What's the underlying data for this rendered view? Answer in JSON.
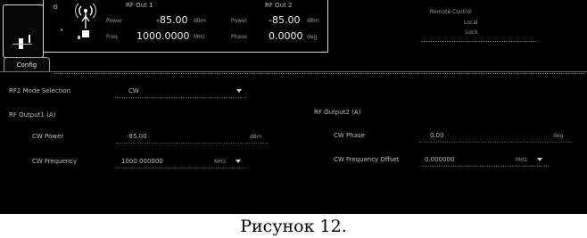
{
  "header": {
    "rf1": {
      "title": "RF Out 1",
      "power_label": "Power",
      "power_value": "-85.00",
      "power_unit": "dBm",
      "freq_label": "Freq",
      "freq_value": "1000.0000",
      "freq_unit": "MHz"
    },
    "rf2": {
      "title": "RF Out 2",
      "power_label": "Power",
      "power_value": "-85.00",
      "power_unit": "dBm",
      "phase_label": "Phase",
      "phase_value": "0.0000",
      "phase_unit": "deg"
    },
    "right_panel": {
      "line1": "Remote Control",
      "line2": "Local",
      "line3": "Lock"
    }
  },
  "tabs": [
    {
      "label": "Config"
    }
  ],
  "form": {
    "mode_label": "RF2 Mode Selection",
    "mode_value": "CW",
    "rf1_section": "RF Output1 (A)",
    "rf2_section": "RF Output2 (A)",
    "rf1_power_label": "CW Power",
    "rf1_power_value": "-85.00",
    "rf1_power_unit": "dBm",
    "rf1_freq_label": "CW Frequency",
    "rf1_freq_value": "1000.000000",
    "rf1_freq_unit": "MHz",
    "rf2_phase_label": "CW Phase",
    "rf2_phase_value": "0.00",
    "rf2_phase_unit": "deg",
    "rf2_offset_label": "CW Frequency Offset",
    "rf2_offset_value": "0.000000",
    "rf2_offset_unit": "MHz"
  },
  "caption": "Рисунок 12."
}
